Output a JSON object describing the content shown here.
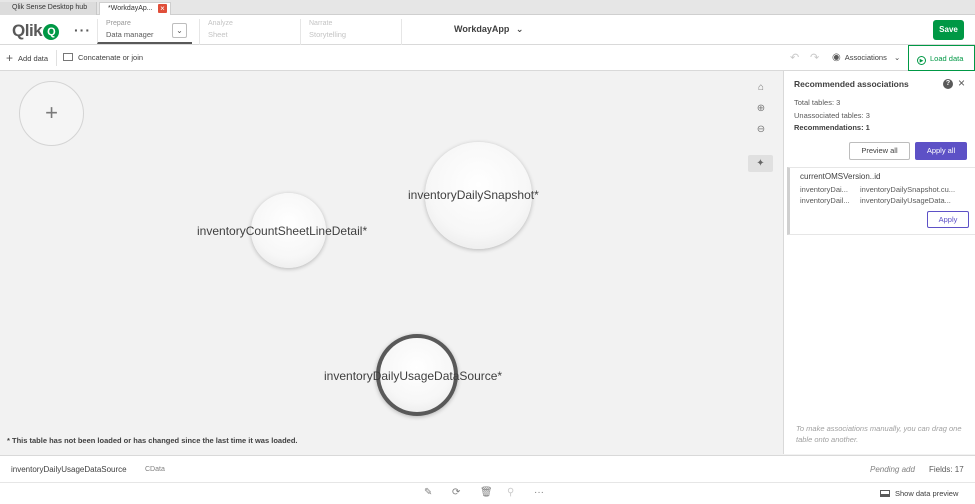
{
  "browser_tabs": [
    {
      "label": "Qlik Sense Desktop hub"
    },
    {
      "label": "*WorkdayAp..."
    }
  ],
  "header": {
    "logo_text": "Qlik",
    "logo_mark": "Q",
    "more_glyph": "···",
    "steps": [
      {
        "title": "Prepare",
        "subtitle": "Data manager"
      },
      {
        "title": "Analyze",
        "subtitle": "Sheet"
      },
      {
        "title": "Narrate",
        "subtitle": "Storytelling"
      }
    ],
    "step_dropdown_glyph": "⌄",
    "app_title": "WorkdayApp",
    "app_title_caret": "⌄",
    "save_label": "Save"
  },
  "toolbar": {
    "add_data_label": "Add data",
    "concat_label": "Concatenate or join",
    "associations_label": "Associations",
    "load_data_label": "Load data"
  },
  "canvas": {
    "tables": [
      {
        "name": "inventoryCountSheetLineDetail*"
      },
      {
        "name": "inventoryDailySnapshot*"
      },
      {
        "name": "inventoryDailyUsageDataSource*"
      }
    ],
    "footnote": "* This table has not been loaded or has changed since the last time it was loaded."
  },
  "panel": {
    "title": "Recommended associations",
    "total_tables": "Total tables: 3",
    "unassociated_tables": "Unassociated tables: 3",
    "recommendations": "Recommendations: 1",
    "preview_all_label": "Preview all",
    "apply_all_label": "Apply all",
    "recommendation": {
      "field": "currentOMSVersion..id",
      "rows": [
        {
          "left": "inventoryDai...",
          "right": "inventoryDailySnapshot.cu..."
        },
        {
          "left": "inventoryDail...",
          "right": "inventoryDailyUsageData..."
        }
      ],
      "apply_label": "Apply"
    },
    "hint": "To make associations manually, you can drag one table onto another."
  },
  "infobar": {
    "table_name": "inventoryDailyUsageDataSource",
    "table_tag": "CData",
    "status": "Pending add",
    "fields": "Fields: 17"
  },
  "actionbar": {
    "show_preview_label": "Show data preview"
  },
  "colors": {
    "brand_green": "#009845",
    "accent_purple": "#5d51c6",
    "selected_ring": "#595959"
  }
}
